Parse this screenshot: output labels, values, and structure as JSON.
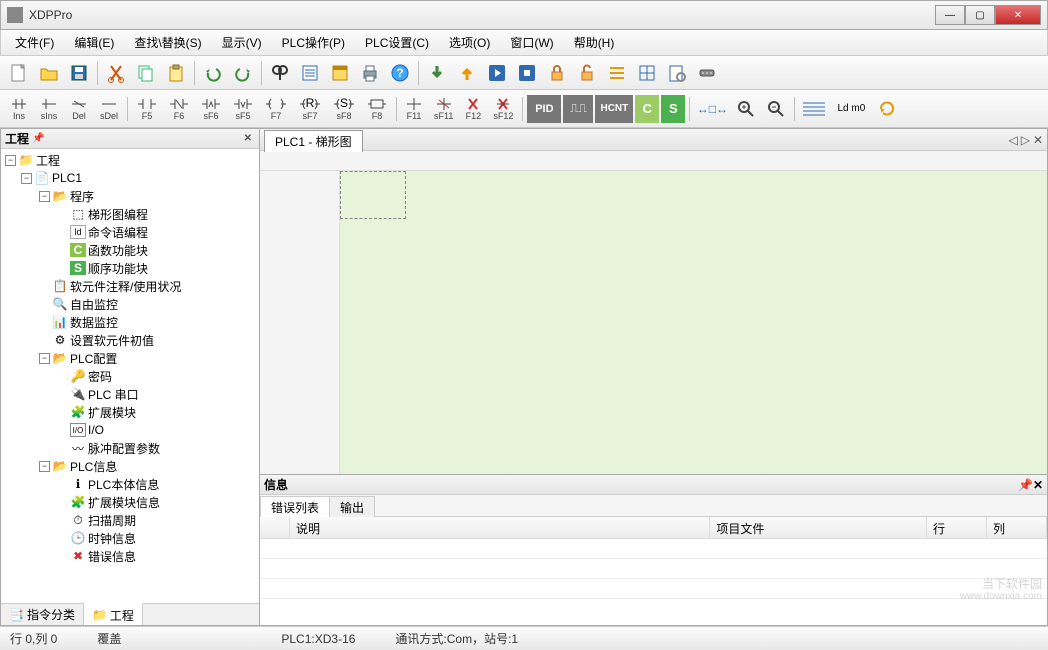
{
  "app": {
    "title": "XDPPro"
  },
  "window_buttons": {
    "min": "—",
    "max": "▢",
    "close": "✕"
  },
  "menu": [
    "文件(F)",
    "编辑(E)",
    "查找\\替换(S)",
    "显示(V)",
    "PLC操作(P)",
    "PLC设置(C)",
    "选项(O)",
    "窗口(W)",
    "帮助(H)"
  ],
  "toolbar2_labels": [
    "Ins",
    "sIns",
    "Del",
    "sDel",
    "F5",
    "F6",
    "sF6",
    "sF5",
    "F7",
    "sF7",
    "sF8",
    "F8",
    "F11",
    "sF11",
    "F12",
    "sF12"
  ],
  "toolbar2_right": [
    "PID",
    "⎍⎍",
    "HCNT",
    "C",
    "S"
  ],
  "toolbar2_far": [
    "↔□↔",
    "🔍",
    "🔍",
    "≣",
    "Ld m0",
    "⟳"
  ],
  "sidebar": {
    "title": "工程",
    "root": "工程",
    "plc": "PLC1",
    "program": "程序",
    "program_children": [
      "梯形图编程",
      "命令语编程",
      "函数功能块",
      "顺序功能块"
    ],
    "items_mid": [
      "软元件注释/使用状况",
      "自由监控",
      "数据监控",
      "设置软元件初值"
    ],
    "plc_config": "PLC配置",
    "plc_config_children": [
      "密码",
      "PLC 串口",
      "扩展模块",
      "I/O",
      "脉冲配置参数"
    ],
    "plc_info": "PLC信息",
    "plc_info_children": [
      "PLC本体信息",
      "扩展模块信息",
      "扫描周期",
      "时钟信息",
      "错误信息"
    ],
    "tabs": {
      "tab1": "指令分类",
      "tab2": "工程"
    }
  },
  "document": {
    "tab": "PLC1 - 梯形图"
  },
  "info_panel": {
    "title": "信息",
    "tabs": {
      "errors": "错误列表",
      "output": "输出"
    },
    "columns": {
      "desc": "说明",
      "project": "项目文件",
      "row": "行",
      "col": "列"
    }
  },
  "status": {
    "pos": "行 0,列 0",
    "mode": "覆盖",
    "plc": "PLC1:XD3-16",
    "comm": "通讯方式:Com，站号:1"
  },
  "watermark": {
    "line1": "当下软件园",
    "line2": "www.downxia.com"
  }
}
